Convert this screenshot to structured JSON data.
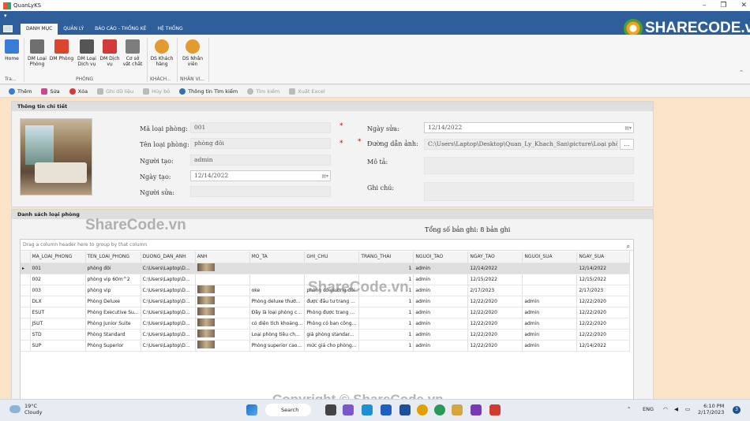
{
  "window": {
    "title": "QuanLyKS"
  },
  "ribbon": {
    "tabs": [
      "DANH MỤC",
      "QUẢN LÝ",
      "BÁO CÁO - THỐNG KÊ",
      "HỆ THỐNG"
    ],
    "buttons": [
      {
        "label": "Home",
        "icon": "home-icon",
        "color": "#3a7bd5"
      },
      {
        "label": "DM Loại Phòng",
        "icon": "building-icon",
        "color": "#6f6f6f"
      },
      {
        "label": "DM Phòng",
        "icon": "store-icon",
        "color": "#d9452f"
      },
      {
        "label": "DM Loại Dịch vụ",
        "icon": "cutlery-icon",
        "color": "#555555"
      },
      {
        "label": "DM Dịch vụ",
        "icon": "cart-icon",
        "color": "#d23a3a"
      },
      {
        "label": "Cơ sở vật chất",
        "icon": "bed-icon",
        "color": "#7d7d7d"
      },
      {
        "label": "DS Khách hàng",
        "icon": "person-icon",
        "color": "#e39a2f"
      },
      {
        "label": "DS Nhân viên",
        "icon": "staff-icon",
        "color": "#e39a2f"
      }
    ],
    "groups": [
      "Tra...",
      "PHÒNG",
      "KHÁCH...",
      "NHÂN VI..."
    ]
  },
  "toolbar": [
    {
      "label": "Thêm",
      "icon": "add-icon",
      "enabled": true
    },
    {
      "label": "Sửa",
      "icon": "edit-icon",
      "enabled": true
    },
    {
      "label": "Xóa",
      "icon": "delete-icon",
      "enabled": true
    },
    {
      "label": "Ghi dữ liệu",
      "icon": "save-icon",
      "enabled": false
    },
    {
      "label": "Hủy bỏ",
      "icon": "undo-icon",
      "enabled": false
    },
    {
      "label": "Thông tin Tìm kiếm",
      "icon": "info-icon",
      "enabled": true
    },
    {
      "label": "Tìm kiếm",
      "icon": "search-icon",
      "enabled": false
    },
    {
      "label": "Xuất Excel",
      "icon": "excel-icon",
      "enabled": false
    }
  ],
  "detail": {
    "header": "Thông tin chi tiết",
    "ma_loai_phong": {
      "label": "Mã loại phòng:",
      "value": "001"
    },
    "ten_loai_phong": {
      "label": "Tên loại phòng:",
      "value": "phòng đôi"
    },
    "nguoi_tao": {
      "label": "Người tạo:",
      "value": "admin"
    },
    "ngay_tao": {
      "label": "Ngày tạo:",
      "value": "12/14/2022"
    },
    "nguoi_sua": {
      "label": "Người sửa:",
      "value": ""
    },
    "ngay_sua": {
      "label": "Ngày sửa:",
      "value": "12/14/2022"
    },
    "duong_dan_anh": {
      "label": "Đường dẫn ảnh:",
      "value": "C:\\Users\\Laptop\\Desktop\\Quan_Ly_Khach_San\\picture\\Loại phòng\\P"
    },
    "mo_ta": {
      "label": "Mô tả:",
      "value": ""
    },
    "ghi_chu": {
      "label": "Ghi chú:",
      "value": ""
    },
    "browse": "..."
  },
  "list": {
    "header": "Danh sách loại phòng",
    "count": "Tổng số bản ghi: 8 bản ghi",
    "group_hint": "Drag a column header here to group by that column",
    "columns": [
      "MA_LOAI_PHONG",
      "TEN_LOAI_PHONG",
      "DUONG_DAN_ANH",
      "ANH",
      "MO_TA",
      "GHI_CHU",
      "TRANG_THAI",
      "NGUOI_TAO",
      "NGAY_TAO",
      "NGUOI_SUA",
      "NGAY_SUA"
    ],
    "rows": [
      [
        "001",
        "phòng đôi",
        "C:\\Users\\Laptop\\D...",
        "thumb",
        "",
        "",
        "1",
        "admin",
        "12/14/2022",
        "",
        "12/14/2022"
      ],
      [
        "002",
        "phòng vip 60m^2",
        "C:\\Users\\Laptop\\D...",
        "",
        "",
        "",
        "1",
        "admin",
        "12/15/2022",
        "",
        "12/15/2022"
      ],
      [
        "003",
        "phòng vip",
        "C:\\Users\\Laptop\\D...",
        "thumb",
        "oke",
        "phòng có giường đôi",
        "1",
        "admin",
        "2/17/2023",
        "",
        "2/17/2023"
      ],
      [
        "DLX",
        "Phòng Deluxe",
        "C:\\Users\\Laptop\\D...",
        "thumb",
        "Phòng deluxe thườ...",
        "được đầu tư trang ...",
        "1",
        "admin",
        "12/22/2020",
        "admin",
        "12/22/2020"
      ],
      [
        "ESUT",
        "Phòng Executive Su...",
        "C:\\Users\\Laptop\\D...",
        "thumb",
        "Đây là loại phòng c...",
        "Phòng được trang ...",
        "1",
        "admin",
        "12/22/2020",
        "admin",
        "12/22/2020"
      ],
      [
        "JSUT",
        "Phòng Junior Suite",
        "C:\\Users\\Laptop\\D...",
        "thumb",
        "có diện tích khoảng...",
        "Phòng có ban công...",
        "1",
        "admin",
        "12/22/2020",
        "admin",
        "12/22/2020"
      ],
      [
        "STD",
        "Phòng Standard",
        "C:\\Users\\Laptop\\D...",
        "thumb",
        "Loại phòng tiêu ch...",
        "giá phòng standar...",
        "1",
        "admin",
        "12/22/2020",
        "admin",
        "12/22/2020"
      ],
      [
        "SUP",
        "Phòng Superior",
        "C:\\Users\\Laptop\\D...",
        "thumb",
        "Phòng superior cao...",
        "mức giá cho phòng...",
        "1",
        "admin",
        "12/22/2020",
        "admin",
        "12/14/2022"
      ]
    ]
  },
  "watermarks": {
    "logo": "SHARECODE.vn",
    "mid1": "ShareCode.vn",
    "mid2": "ShareCode.vn",
    "copyright": "Copyright © ShareCode.vn"
  },
  "taskbar": {
    "weather_temp": "19°C",
    "weather_desc": "Cloudy",
    "search": "Search",
    "lang": "ENG",
    "time": "6:10 PM",
    "date": "2/17/2023",
    "notif": "3"
  }
}
